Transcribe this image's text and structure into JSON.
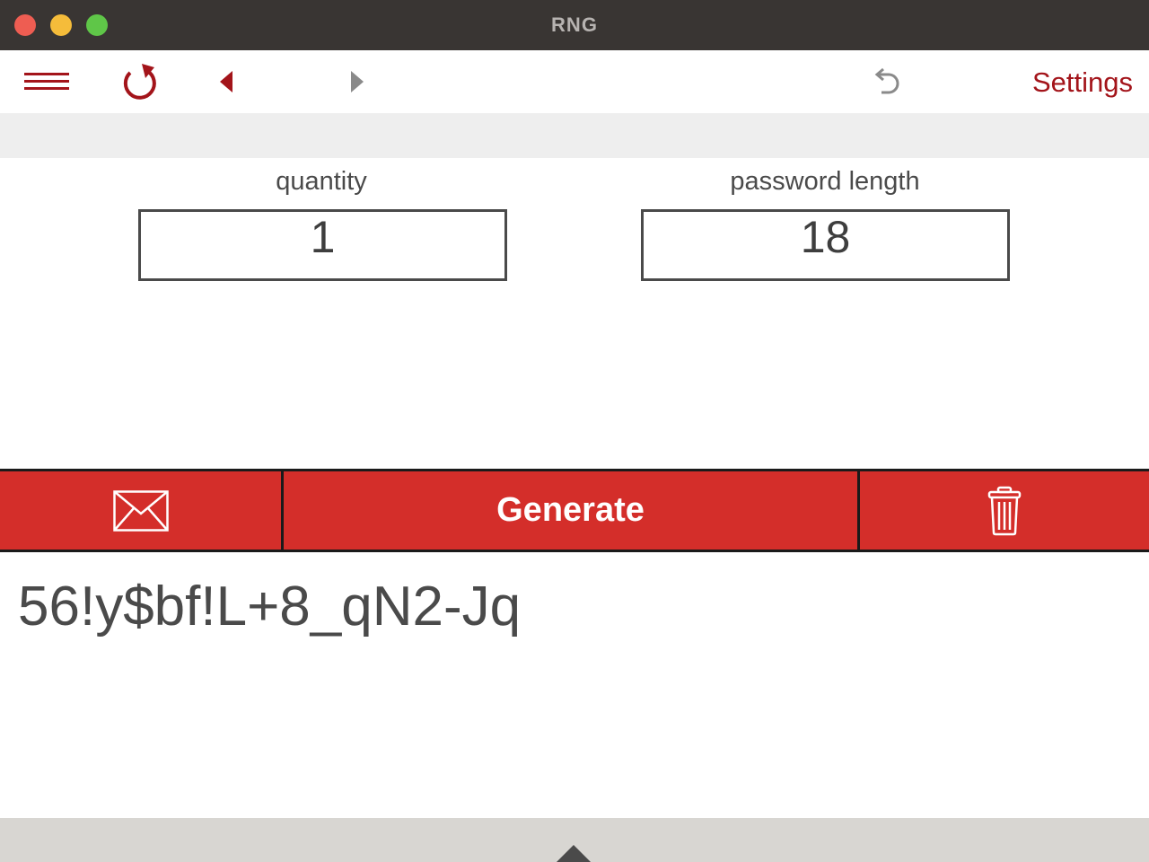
{
  "window": {
    "title": "RNG"
  },
  "toolbar": {
    "menu_icon": "hamburger-menu-icon",
    "refresh_icon": "refresh-icon",
    "back_icon": "triangle-left-icon",
    "forward_icon": "triangle-right-icon",
    "undo_icon": "undo-arrow-icon",
    "settings_label": "Settings"
  },
  "fields": {
    "quantity": {
      "label": "quantity",
      "value": "1"
    },
    "password_length": {
      "label": "password length",
      "value": "18"
    }
  },
  "actions": {
    "mail_icon": "envelope-icon",
    "generate_label": "Generate",
    "trash_icon": "trash-icon"
  },
  "output": {
    "text": "56!y$bf!L+8_qN2-Jq"
  },
  "colors": {
    "accent": "#a3141a",
    "action_bar": "#d42e2a",
    "titlebar": "#393533",
    "disabled_icon": "#8a8a8a"
  }
}
